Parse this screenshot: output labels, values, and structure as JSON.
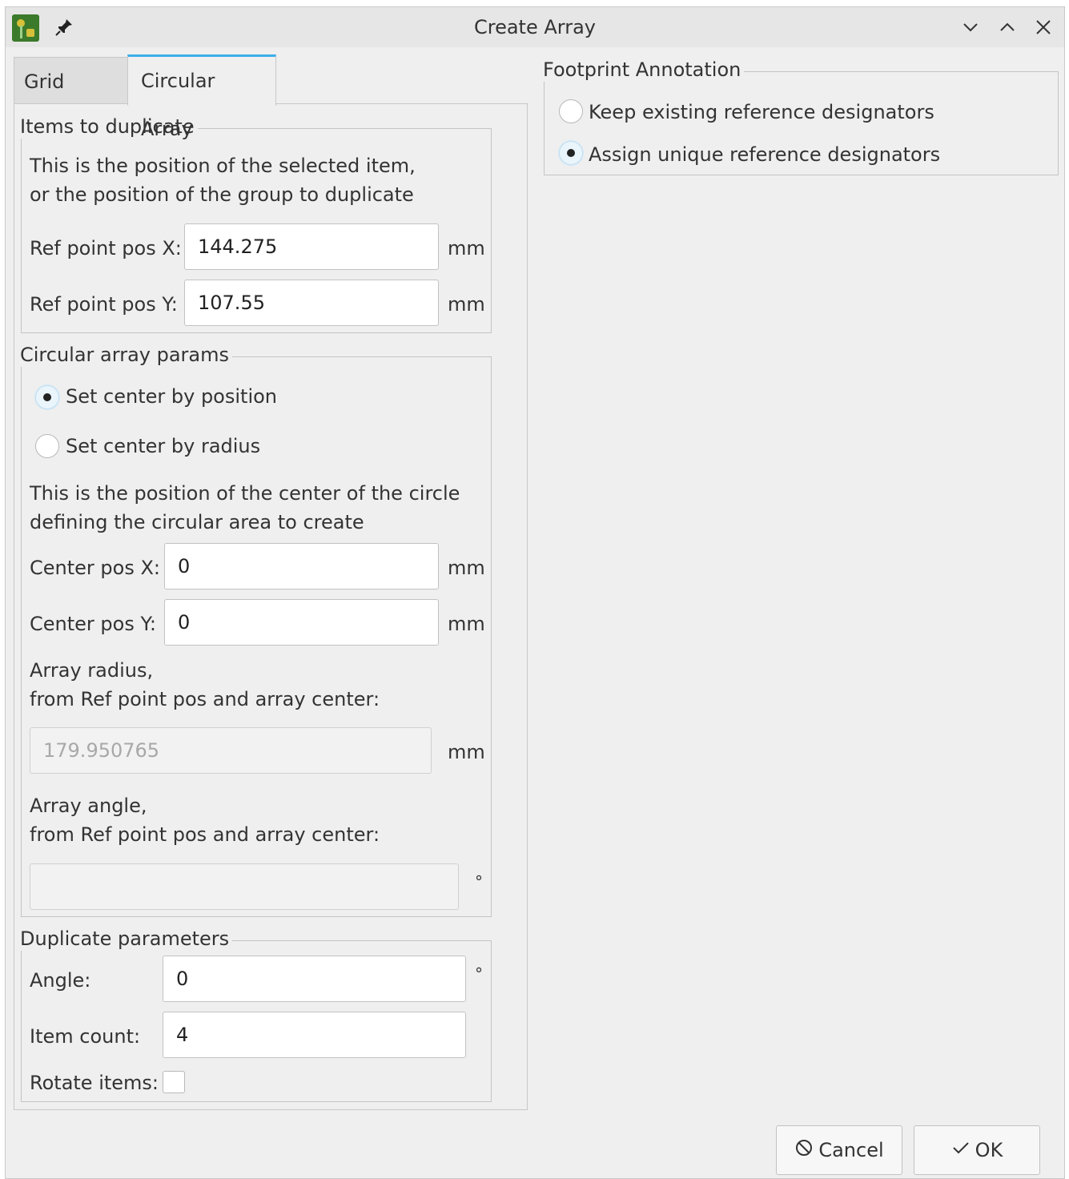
{
  "window": {
    "title": "Create Array"
  },
  "tabs": [
    {
      "label": "Grid Array"
    },
    {
      "label": "Circular Array"
    }
  ],
  "items_group": {
    "title": "Items to duplicate",
    "description_line1": "This is the position of the selected item,",
    "description_line2": "or the position of the group to duplicate",
    "ref_x": {
      "label": "Ref point pos X:",
      "value": "144.275",
      "unit": "mm"
    },
    "ref_y": {
      "label": "Ref point pos Y:",
      "value": "107.55",
      "unit": "mm"
    }
  },
  "circular_group": {
    "title": "Circular array params",
    "radio_position": {
      "label": "Set center by position",
      "checked": true
    },
    "radio_radius": {
      "label": "Set center by radius",
      "checked": false
    },
    "description_line1": "This is the position of the center of the circle",
    "description_line2": "defining the circular area to create",
    "center_x": {
      "label": "Center pos X:",
      "value": "0",
      "unit": "mm"
    },
    "center_y": {
      "label": "Center pos Y:",
      "value": "0",
      "unit": "mm"
    },
    "radius_label_line1": "Array radius,",
    "radius_label_line2": "from Ref point pos and array center:",
    "radius": {
      "value": "179.950765",
      "unit": "mm"
    },
    "angle_label_line1": "Array angle,",
    "angle_label_line2": "from Ref point pos and array center:",
    "angle": {
      "value": "",
      "unit": "°"
    }
  },
  "duplicate_group": {
    "title": "Duplicate parameters",
    "angle": {
      "label": "Angle:",
      "value": "0",
      "unit": "°"
    },
    "item_count": {
      "label": "Item count:",
      "value": "4"
    },
    "rotate": {
      "label": "Rotate items:",
      "checked": false
    }
  },
  "annotation_group": {
    "title": "Footprint Annotation",
    "keep": {
      "label": "Keep existing reference designators",
      "checked": false
    },
    "assign": {
      "label": "Assign unique reference designators",
      "checked": true
    }
  },
  "buttons": {
    "cancel": "Cancel",
    "ok": "OK"
  }
}
